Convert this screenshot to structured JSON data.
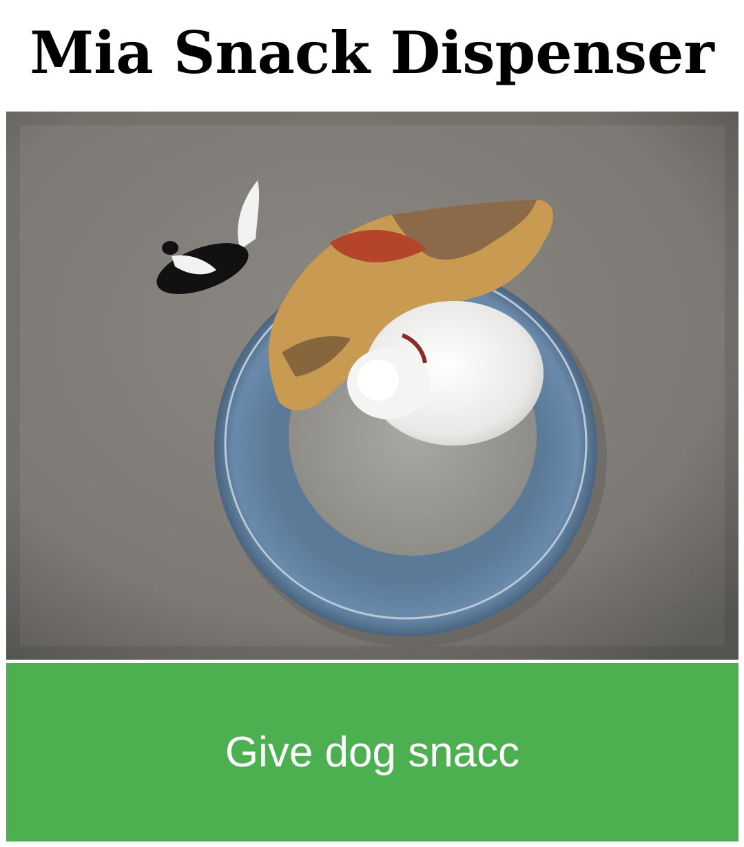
{
  "header": {
    "title": "Mia Snack Dispenser"
  },
  "camera": {
    "description_icon": "camera-feed-image"
  },
  "actions": {
    "snack_button_label": "Give dog snacc"
  },
  "colors": {
    "button_background": "#4caf50",
    "button_text": "#ffffff",
    "title_text": "#000000"
  }
}
